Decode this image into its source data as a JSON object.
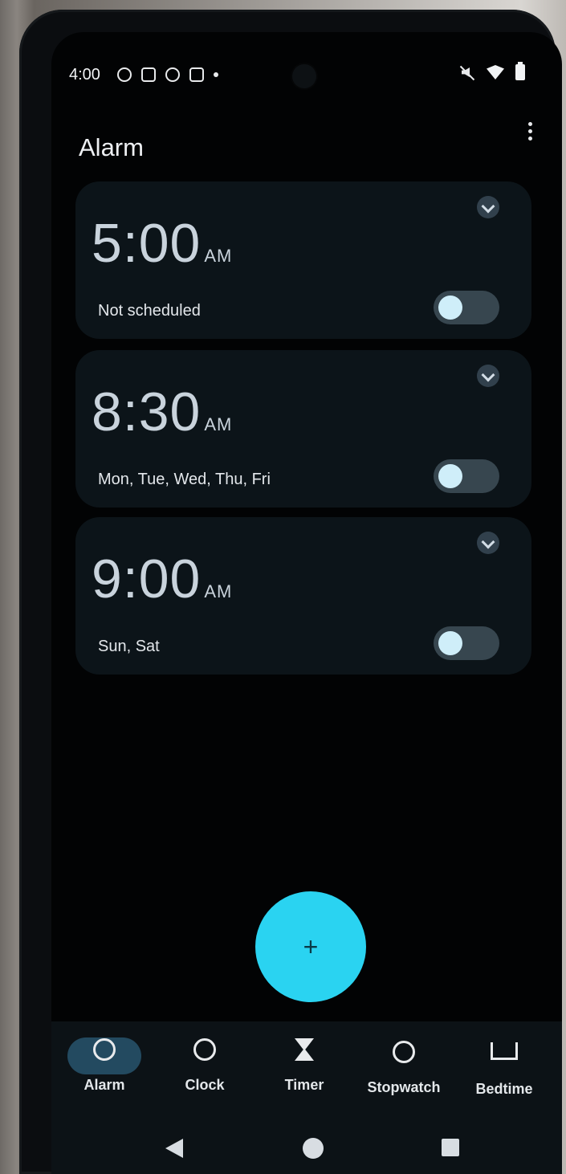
{
  "status_bar": {
    "time": "4:00"
  },
  "header": {
    "title": "Alarm"
  },
  "alarms": [
    {
      "time": "5:00",
      "ampm": "AM",
      "schedule": "Not scheduled",
      "enabled": false
    },
    {
      "time": "8:30",
      "ampm": "AM",
      "schedule": "Mon, Tue, Wed, Thu, Fri",
      "enabled": false
    },
    {
      "time": "9:00",
      "ampm": "AM",
      "schedule": "Sun, Sat",
      "enabled": false
    }
  ],
  "fab": {
    "icon": "+"
  },
  "bottom_nav": [
    {
      "label": "Alarm",
      "icon": "alarm-icon",
      "selected": true
    },
    {
      "label": "Clock",
      "icon": "clock-icon",
      "selected": false
    },
    {
      "label": "Timer",
      "icon": "timer-icon",
      "selected": false
    },
    {
      "label": "Stopwatch",
      "icon": "stopwatch-icon",
      "selected": false
    },
    {
      "label": "Bedtime",
      "icon": "bedtime-icon",
      "selected": false
    }
  ],
  "colors": {
    "accent": "#2ad3f1",
    "card": "#0c1419",
    "toggle_track": "#37464f",
    "toggle_knob": "#cfeef9",
    "selected_pill": "#234a60"
  }
}
